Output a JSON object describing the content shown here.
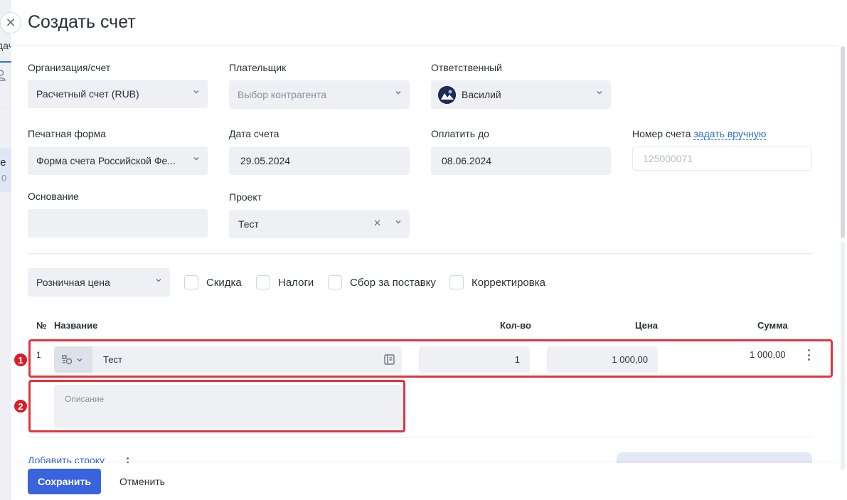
{
  "backdrop": {
    "tab_fragment": "дач",
    "row_text": "яе",
    "row_count": "0"
  },
  "modal": {
    "title": "Создать счет"
  },
  "form": {
    "org": {
      "label": "Организация/счет",
      "value": "Расчетный счет (RUB)"
    },
    "payer": {
      "label": "Плательщик",
      "placeholder": "Выбор контрагента"
    },
    "responsible": {
      "label": "Ответственный",
      "value": "Василий"
    },
    "print_form": {
      "label": "Печатная форма",
      "value": "Форма счета Российской Фе..."
    },
    "invoice_date": {
      "label": "Дата счета",
      "value": "29.05.2024"
    },
    "pay_until": {
      "label": "Оплатить до",
      "value": "08.06.2024"
    },
    "invoice_number": {
      "label": "Номер счета",
      "link": "задать вручную",
      "placeholder": "125000071"
    },
    "basis": {
      "label": "Основание",
      "value": ""
    },
    "project": {
      "label": "Проект",
      "value": "Тест"
    }
  },
  "pricing": {
    "price_type": "Розничная цена",
    "checks": [
      "Скидка",
      "Налоги",
      "Сбор за поставку",
      "Корректировка"
    ]
  },
  "table": {
    "headers": {
      "num": "№",
      "name": "Название",
      "qty": "Кол-во",
      "price": "Цена",
      "sum": "Сумма"
    },
    "rows": [
      {
        "num": "1",
        "name": "Тест",
        "qty": "1",
        "price": "1 000,00",
        "sum": "1 000,00",
        "description_placeholder": "Описание"
      }
    ]
  },
  "annotations": [
    "1",
    "2"
  ],
  "actions": {
    "add_row": "Добавить строку",
    "save": "Сохранить",
    "cancel": "Отменить"
  },
  "colors": {
    "accent": "#3a64de",
    "link": "#2f6fd6",
    "highlight": "#e0343c",
    "field_bg": "#eef0f4"
  }
}
